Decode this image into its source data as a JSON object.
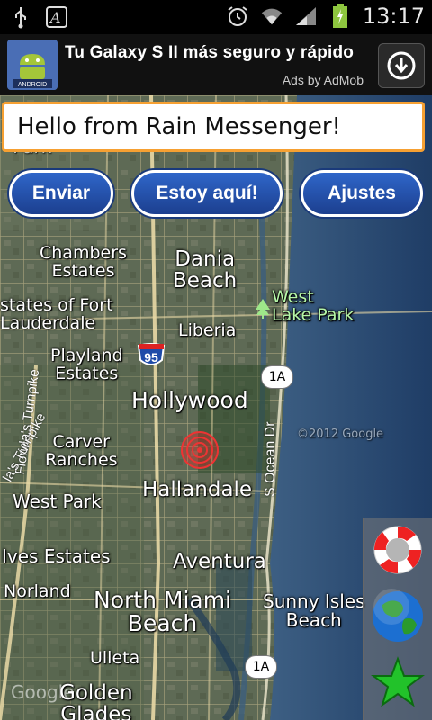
{
  "status_bar": {
    "time": "13:17"
  },
  "ad": {
    "logo_text": "ANDROID",
    "title": "Tu Galaxy S II más seguro y rápido",
    "byline": "Ads by AdMob"
  },
  "message": {
    "value": "Hello from Rain Messenger!"
  },
  "buttons": {
    "send": "Enviar",
    "here": "Estoy aquí!",
    "settings": "Ajustes"
  },
  "map": {
    "labels": {
      "park": "Park",
      "chambers": "Chambers\nEstates",
      "dania": "Dania\nBeach",
      "west_lake": "West\nLake Park",
      "fort": "states of Fort\nLauderdale",
      "liberia": "Liberia",
      "playland": "Playland\nEstates",
      "hollywood": "Hollywood",
      "carver": "Carver\nRanches",
      "hallandale": "Hallandale",
      "west_park": "West Park",
      "ives": "Ives Estates",
      "aventura": "Aventura",
      "norland": "Norland",
      "north_miami": "North Miami\nBeach",
      "sunny": "Sunny Isles\nBeach",
      "ulleta": "Ulleta",
      "golden": "Golden\nGlades",
      "ocean_dr": "S Ocean Dr",
      "turnpike": "Florida's Turnpike",
      "turnpike2": "la's Turnpike"
    },
    "shields": {
      "i95": "95",
      "a1a_1": "1A",
      "a1a_2": "1A"
    },
    "watermark": "Google",
    "watermark2": "©2012 Google"
  },
  "side_panel": {
    "items": [
      "lifebuoy-icon",
      "globe-icon",
      "star-icon"
    ]
  }
}
